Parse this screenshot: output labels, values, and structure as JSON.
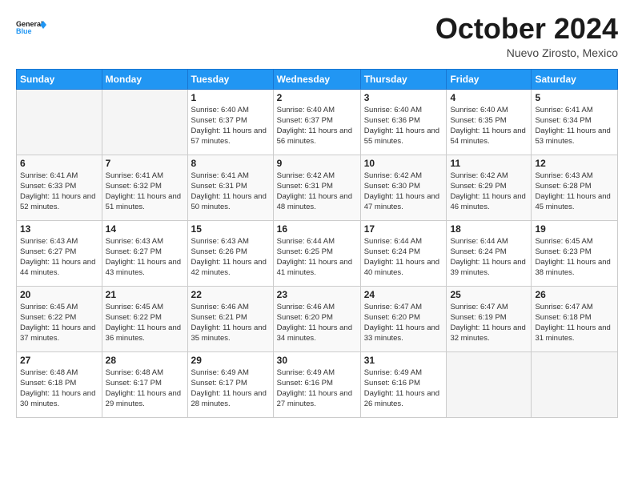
{
  "logo": {
    "text_general": "General",
    "text_blue": "Blue"
  },
  "title": "October 2024",
  "subtitle": "Nuevo Zirosto, Mexico",
  "days_of_week": [
    "Sunday",
    "Monday",
    "Tuesday",
    "Wednesday",
    "Thursday",
    "Friday",
    "Saturday"
  ],
  "weeks": [
    [
      {
        "day": "",
        "empty": true
      },
      {
        "day": "",
        "empty": true
      },
      {
        "day": "1",
        "sunrise": "Sunrise: 6:40 AM",
        "sunset": "Sunset: 6:37 PM",
        "daylight": "Daylight: 11 hours and 57 minutes."
      },
      {
        "day": "2",
        "sunrise": "Sunrise: 6:40 AM",
        "sunset": "Sunset: 6:37 PM",
        "daylight": "Daylight: 11 hours and 56 minutes."
      },
      {
        "day": "3",
        "sunrise": "Sunrise: 6:40 AM",
        "sunset": "Sunset: 6:36 PM",
        "daylight": "Daylight: 11 hours and 55 minutes."
      },
      {
        "day": "4",
        "sunrise": "Sunrise: 6:40 AM",
        "sunset": "Sunset: 6:35 PM",
        "daylight": "Daylight: 11 hours and 54 minutes."
      },
      {
        "day": "5",
        "sunrise": "Sunrise: 6:41 AM",
        "sunset": "Sunset: 6:34 PM",
        "daylight": "Daylight: 11 hours and 53 minutes."
      }
    ],
    [
      {
        "day": "6",
        "sunrise": "Sunrise: 6:41 AM",
        "sunset": "Sunset: 6:33 PM",
        "daylight": "Daylight: 11 hours and 52 minutes."
      },
      {
        "day": "7",
        "sunrise": "Sunrise: 6:41 AM",
        "sunset": "Sunset: 6:32 PM",
        "daylight": "Daylight: 11 hours and 51 minutes."
      },
      {
        "day": "8",
        "sunrise": "Sunrise: 6:41 AM",
        "sunset": "Sunset: 6:31 PM",
        "daylight": "Daylight: 11 hours and 50 minutes."
      },
      {
        "day": "9",
        "sunrise": "Sunrise: 6:42 AM",
        "sunset": "Sunset: 6:31 PM",
        "daylight": "Daylight: 11 hours and 48 minutes."
      },
      {
        "day": "10",
        "sunrise": "Sunrise: 6:42 AM",
        "sunset": "Sunset: 6:30 PM",
        "daylight": "Daylight: 11 hours and 47 minutes."
      },
      {
        "day": "11",
        "sunrise": "Sunrise: 6:42 AM",
        "sunset": "Sunset: 6:29 PM",
        "daylight": "Daylight: 11 hours and 46 minutes."
      },
      {
        "day": "12",
        "sunrise": "Sunrise: 6:43 AM",
        "sunset": "Sunset: 6:28 PM",
        "daylight": "Daylight: 11 hours and 45 minutes."
      }
    ],
    [
      {
        "day": "13",
        "sunrise": "Sunrise: 6:43 AM",
        "sunset": "Sunset: 6:27 PM",
        "daylight": "Daylight: 11 hours and 44 minutes."
      },
      {
        "day": "14",
        "sunrise": "Sunrise: 6:43 AM",
        "sunset": "Sunset: 6:27 PM",
        "daylight": "Daylight: 11 hours and 43 minutes."
      },
      {
        "day": "15",
        "sunrise": "Sunrise: 6:43 AM",
        "sunset": "Sunset: 6:26 PM",
        "daylight": "Daylight: 11 hours and 42 minutes."
      },
      {
        "day": "16",
        "sunrise": "Sunrise: 6:44 AM",
        "sunset": "Sunset: 6:25 PM",
        "daylight": "Daylight: 11 hours and 41 minutes."
      },
      {
        "day": "17",
        "sunrise": "Sunrise: 6:44 AM",
        "sunset": "Sunset: 6:24 PM",
        "daylight": "Daylight: 11 hours and 40 minutes."
      },
      {
        "day": "18",
        "sunrise": "Sunrise: 6:44 AM",
        "sunset": "Sunset: 6:24 PM",
        "daylight": "Daylight: 11 hours and 39 minutes."
      },
      {
        "day": "19",
        "sunrise": "Sunrise: 6:45 AM",
        "sunset": "Sunset: 6:23 PM",
        "daylight": "Daylight: 11 hours and 38 minutes."
      }
    ],
    [
      {
        "day": "20",
        "sunrise": "Sunrise: 6:45 AM",
        "sunset": "Sunset: 6:22 PM",
        "daylight": "Daylight: 11 hours and 37 minutes."
      },
      {
        "day": "21",
        "sunrise": "Sunrise: 6:45 AM",
        "sunset": "Sunset: 6:22 PM",
        "daylight": "Daylight: 11 hours and 36 minutes."
      },
      {
        "day": "22",
        "sunrise": "Sunrise: 6:46 AM",
        "sunset": "Sunset: 6:21 PM",
        "daylight": "Daylight: 11 hours and 35 minutes."
      },
      {
        "day": "23",
        "sunrise": "Sunrise: 6:46 AM",
        "sunset": "Sunset: 6:20 PM",
        "daylight": "Daylight: 11 hours and 34 minutes."
      },
      {
        "day": "24",
        "sunrise": "Sunrise: 6:47 AM",
        "sunset": "Sunset: 6:20 PM",
        "daylight": "Daylight: 11 hours and 33 minutes."
      },
      {
        "day": "25",
        "sunrise": "Sunrise: 6:47 AM",
        "sunset": "Sunset: 6:19 PM",
        "daylight": "Daylight: 11 hours and 32 minutes."
      },
      {
        "day": "26",
        "sunrise": "Sunrise: 6:47 AM",
        "sunset": "Sunset: 6:18 PM",
        "daylight": "Daylight: 11 hours and 31 minutes."
      }
    ],
    [
      {
        "day": "27",
        "sunrise": "Sunrise: 6:48 AM",
        "sunset": "Sunset: 6:18 PM",
        "daylight": "Daylight: 11 hours and 30 minutes."
      },
      {
        "day": "28",
        "sunrise": "Sunrise: 6:48 AM",
        "sunset": "Sunset: 6:17 PM",
        "daylight": "Daylight: 11 hours and 29 minutes."
      },
      {
        "day": "29",
        "sunrise": "Sunrise: 6:49 AM",
        "sunset": "Sunset: 6:17 PM",
        "daylight": "Daylight: 11 hours and 28 minutes."
      },
      {
        "day": "30",
        "sunrise": "Sunrise: 6:49 AM",
        "sunset": "Sunset: 6:16 PM",
        "daylight": "Daylight: 11 hours and 27 minutes."
      },
      {
        "day": "31",
        "sunrise": "Sunrise: 6:49 AM",
        "sunset": "Sunset: 6:16 PM",
        "daylight": "Daylight: 11 hours and 26 minutes."
      },
      {
        "day": "",
        "empty": true
      },
      {
        "day": "",
        "empty": true
      }
    ]
  ]
}
